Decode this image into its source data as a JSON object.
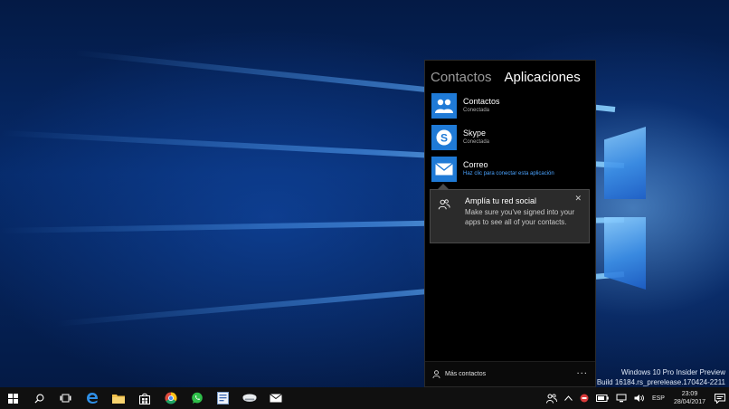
{
  "panel": {
    "tabs": [
      {
        "label": "Contactos",
        "active": false
      },
      {
        "label": "Aplicaciones",
        "active": true
      }
    ],
    "apps": [
      {
        "name": "Contactos",
        "status": "Conectada",
        "icon": "people-icon"
      },
      {
        "name": "Skype",
        "status": "Conectada",
        "icon": "skype-icon"
      },
      {
        "name": "Correo",
        "status": "Haz clic para conectar esta aplicación",
        "icon": "mail-icon"
      }
    ],
    "tooltip": {
      "title": "Amplía tu red social",
      "body": "Make sure you've signed into your apps to see all of your contacts.",
      "close": "✕"
    },
    "footer": {
      "more_contacts": "Más contactos",
      "more_menu": "···"
    }
  },
  "watermark": {
    "line1": "Windows 10 Pro Insider Preview",
    "line2": "uación. Build 16184.rs_prerelease.170424-2211"
  },
  "taskbar": {
    "tray_language": "ESP",
    "time": "23:09",
    "date": "28/04/2017"
  },
  "colors": {
    "accent": "#1f7ad6",
    "link": "#4aa3ff",
    "panel_bg": "#000000",
    "taskbar_bg": "#101010"
  }
}
